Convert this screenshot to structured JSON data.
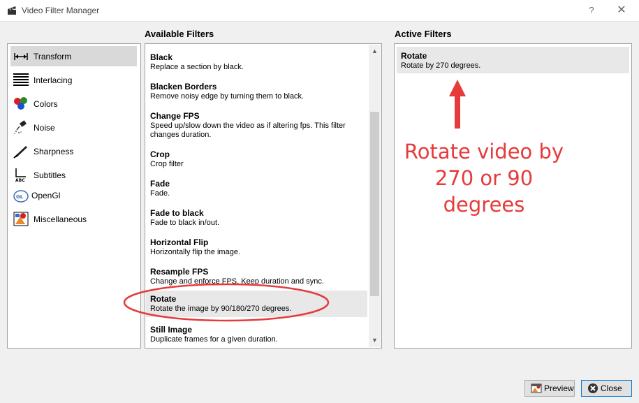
{
  "window": {
    "title": "Video Filter Manager",
    "help_glyph": "?",
    "close_glyph": "✕"
  },
  "headers": {
    "available": "Available Filters",
    "active": "Active Filters"
  },
  "categories": [
    {
      "label": "Transform",
      "icon": "transform-icon",
      "selected": true
    },
    {
      "label": "Interlacing",
      "icon": "interlacing-icon"
    },
    {
      "label": "Colors",
      "icon": "colors-icon"
    },
    {
      "label": "Noise",
      "icon": "noise-icon"
    },
    {
      "label": "Sharpness",
      "icon": "sharpness-icon"
    },
    {
      "label": "Subtitles",
      "icon": "subtitles-icon"
    },
    {
      "label": "OpenGl",
      "icon": "opengl-icon"
    },
    {
      "label": "Miscellaneous",
      "icon": "miscellaneous-icon"
    }
  ],
  "available_filters": [
    {
      "name": "Black",
      "desc": "Replace a section by black."
    },
    {
      "name": "Blacken Borders",
      "desc": "Remove noisy edge by turning them to black."
    },
    {
      "name": "Change FPS",
      "desc": "Speed up/slow down the video as if altering fps. This filter changes duration."
    },
    {
      "name": "Crop",
      "desc": "Crop filter"
    },
    {
      "name": "Fade",
      "desc": "Fade."
    },
    {
      "name": "Fade to black",
      "desc": "Fade to black in/out."
    },
    {
      "name": "Horizontal Flip",
      "desc": "Horizontally flip the image."
    },
    {
      "name": "Resample FPS",
      "desc": "Change and enforce FPS. Keep duration and sync."
    },
    {
      "name": "Rotate",
      "desc": "Rotate the image by 90/180/270 degrees.",
      "selected": true
    },
    {
      "name": "Still Image",
      "desc": "Duplicate frames for a given duration."
    }
  ],
  "active_filters": [
    {
      "name": "Rotate",
      "desc": "Rotate by 270 degrees."
    }
  ],
  "annotation": {
    "line1": "Rotate video by",
    "line2": "270 or 90",
    "line3": "degrees",
    "color": "#e63b3b"
  },
  "buttons": {
    "preview": "Preview",
    "close": "Close"
  }
}
